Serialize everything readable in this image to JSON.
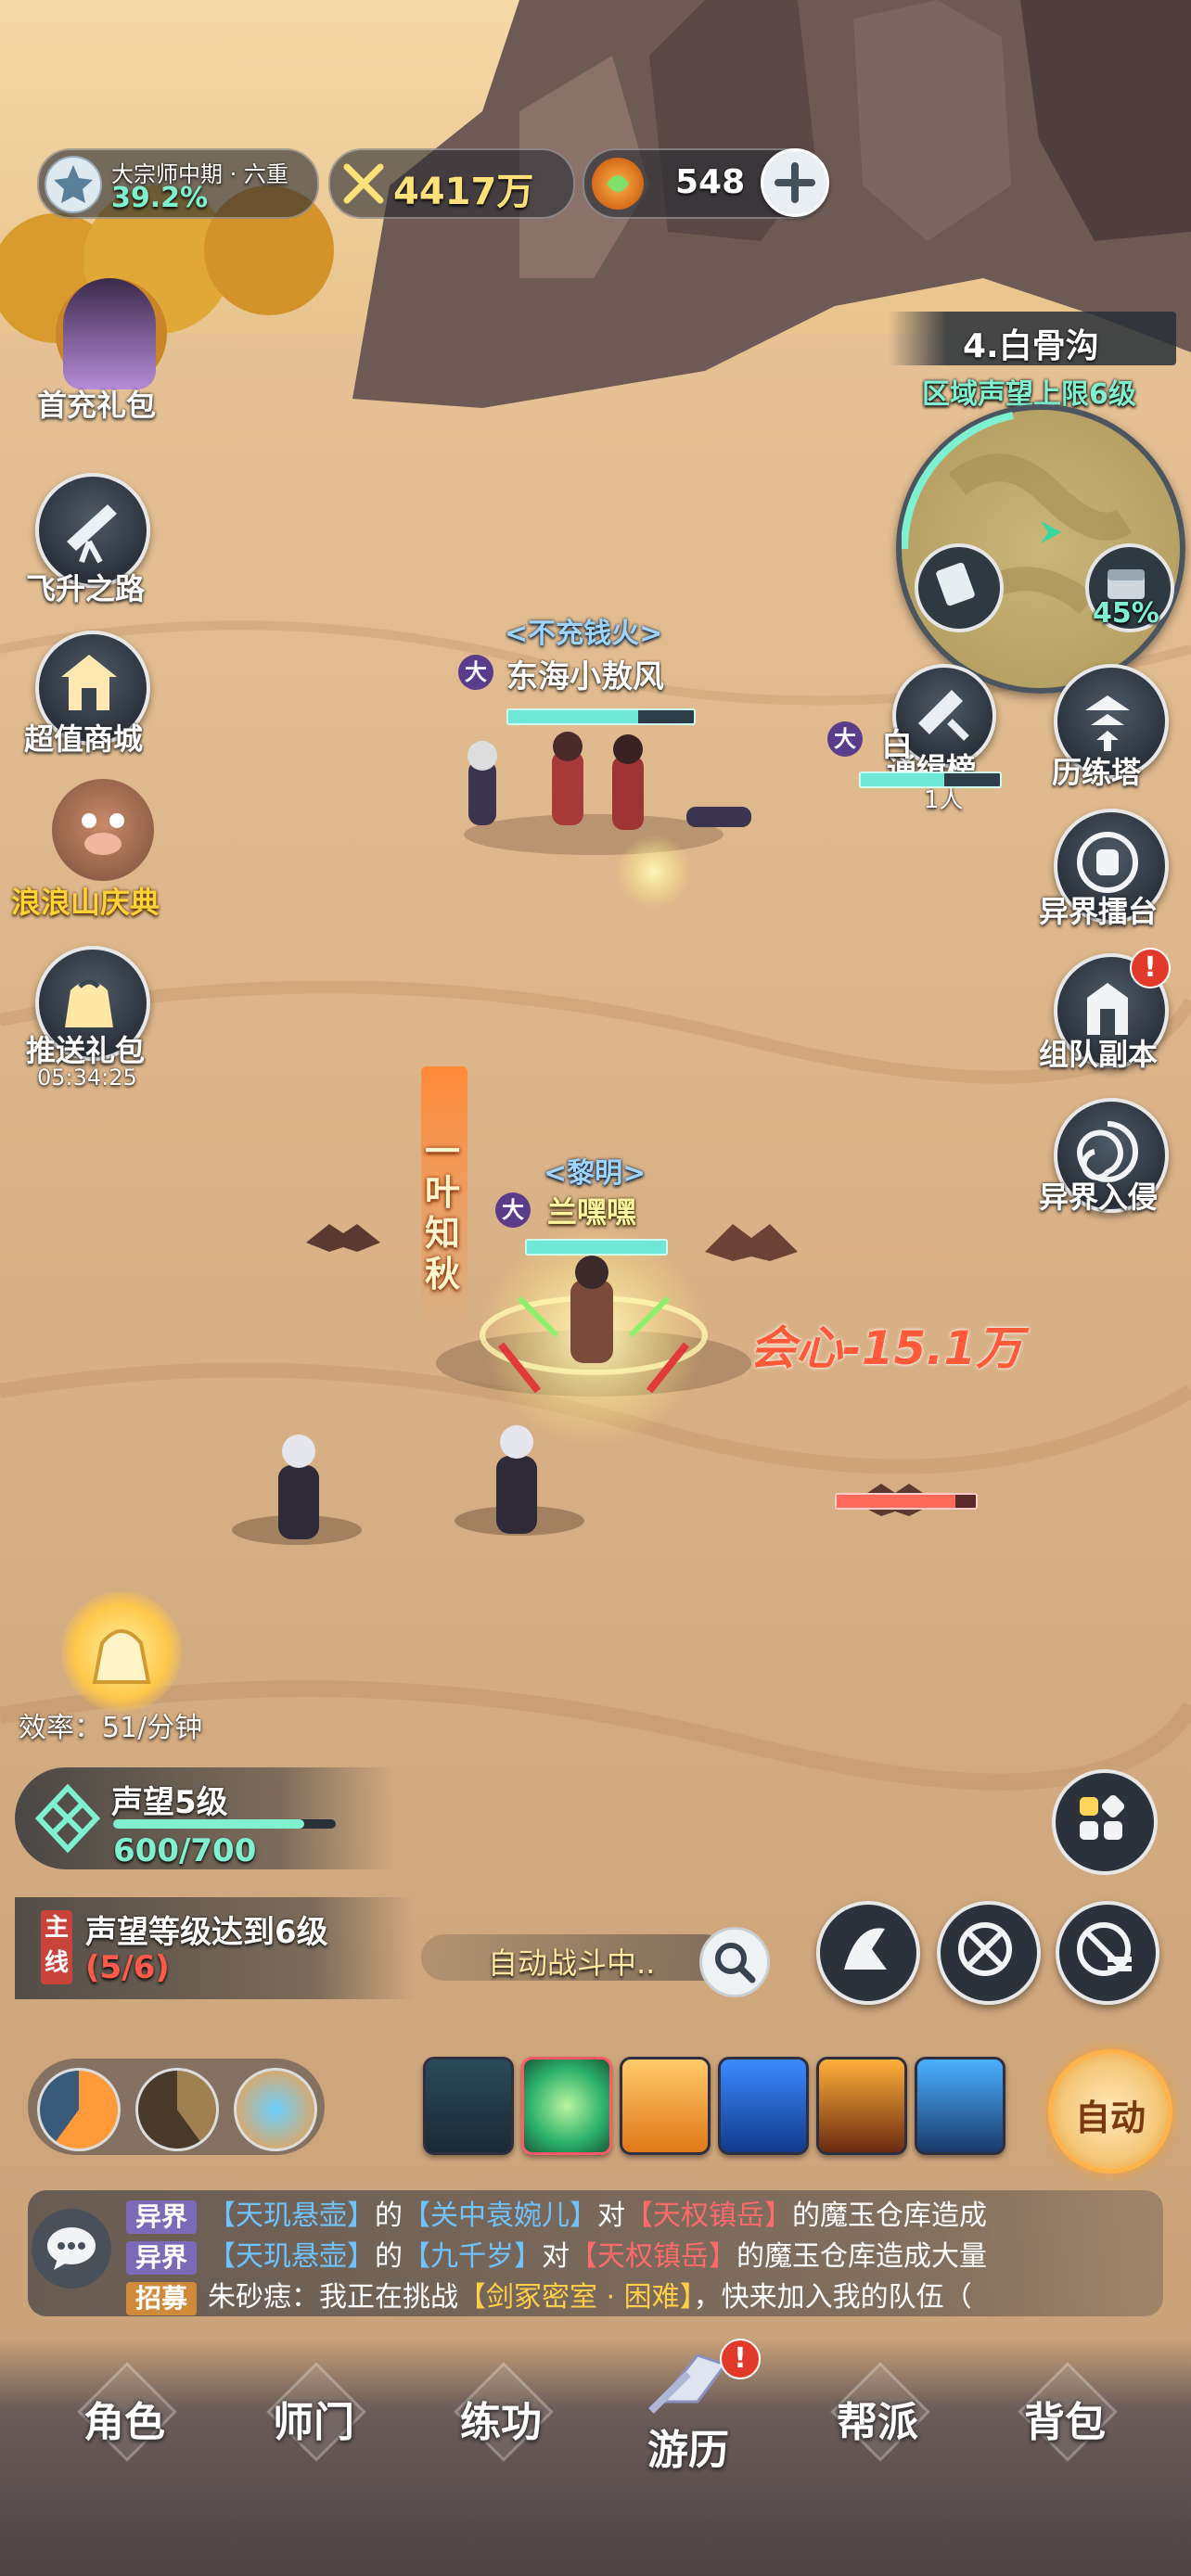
{
  "hud": {
    "rank_title": "大宗师中期 · 六重",
    "rank_progress": "39.2%",
    "power": "4417万",
    "currency_amount": "548",
    "colors": {
      "accent_green": "#7ff0d0",
      "power_gold": "#ffe17a"
    }
  },
  "left_menu": {
    "first_recharge": "首充礼包",
    "ascension_road": "飞升之路",
    "value_shop": "超值商城",
    "festival": "浪浪山庆典",
    "push_gift": "推送礼包",
    "push_gift_timer": "05:34:25"
  },
  "map": {
    "zone_name": "4.白骨沟",
    "reputation_cap": "区域声望上限6级",
    "progress": "45%"
  },
  "right_menu": {
    "wanted_list": "通缉榜",
    "wanted_count": "1人",
    "trial_tower": "历练塔",
    "arena": "异界擂台",
    "team_dungeon": "组队副本",
    "invasion": "异界入侵"
  },
  "world": {
    "npc1_guild": "<不充钱火>",
    "npc1_badge": "大",
    "npc1_name": "东海小敖风",
    "npc2_badge": "大",
    "npc2_name_partial": "白",
    "player_guild": "<黎明>",
    "player_badge": "大",
    "player_name": "兰嘿嘿",
    "skill_callout": "一叶知秋",
    "crit_text": "会心-15.1万"
  },
  "efficiency": {
    "label": "效率：51/分钟"
  },
  "reputation": {
    "level": "声望5级",
    "progress_text": "600/700",
    "progress_fraction": 0.857
  },
  "quest": {
    "tag": "主线",
    "text": "声望等级达到6级",
    "progress": "(5/6)"
  },
  "auto_battle": {
    "status": "自动战斗中..",
    "auto_button": "自动"
  },
  "chat": [
    {
      "tag": "异界",
      "parts": [
        "【天玑悬壶】",
        "的",
        "【关中袁婉儿】",
        "对",
        "【天权镇岳】",
        "的魔玉仓库造成"
      ]
    },
    {
      "tag": "异界",
      "parts": [
        "【天玑悬壶】",
        "的",
        "【九千岁】",
        "对",
        "【天权镇岳】",
        "的魔玉仓库造成大量"
      ]
    },
    {
      "tag": "招募",
      "parts": [
        "朱砂痣：我正在挑战",
        "【剑冢密室 · 困难】",
        "，快来加入我的队伍（"
      ]
    }
  ],
  "bottom_nav": {
    "role": "角色",
    "sect": "师门",
    "practice": "练功",
    "travel": "游历",
    "guild": "帮派",
    "bag": "背包"
  }
}
